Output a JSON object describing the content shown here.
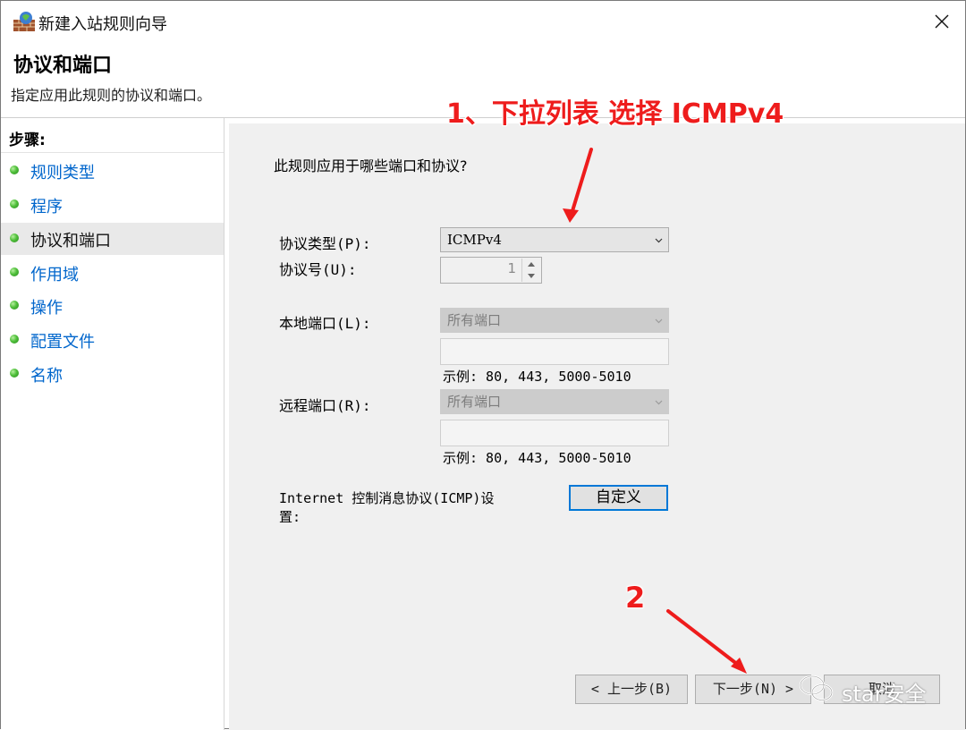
{
  "window": {
    "title": "新建入站规则向导"
  },
  "header": {
    "title": "协议和端口",
    "description": "指定应用此规则的协议和端口。"
  },
  "sidebar": {
    "steps_label": "步骤:",
    "items": [
      {
        "label": "规则类型",
        "active": false
      },
      {
        "label": "程序",
        "active": false
      },
      {
        "label": "协议和端口",
        "active": true
      },
      {
        "label": "作用域",
        "active": false
      },
      {
        "label": "操作",
        "active": false
      },
      {
        "label": "配置文件",
        "active": false
      },
      {
        "label": "名称",
        "active": false
      }
    ]
  },
  "content": {
    "question": "此规则应用于哪些端口和协议?",
    "protocol_type_label": "协议类型(P):",
    "protocol_type_value": "ICMPv4",
    "protocol_number_label": "协议号(U):",
    "protocol_number_value": "1",
    "local_port_label": "本地端口(L):",
    "local_port_value": "所有端口",
    "local_port_hint": "示例: 80, 443, 5000-5010",
    "remote_port_label": "远程端口(R):",
    "remote_port_value": "所有端口",
    "remote_port_hint": "示例: 80, 443, 5000-5010",
    "icmp_label_line1": "Internet 控制消息协议(ICMP)设",
    "icmp_label_line2": "置:",
    "custom_button": "自定义"
  },
  "footer": {
    "back_button": "< 上一步(B)",
    "next_button": "下一步(N) >",
    "cancel_button": "取消"
  },
  "annotations": {
    "step1": "1、下拉列表 选择 ICMPv4",
    "step2": "2"
  },
  "watermark": {
    "text": "star安全"
  },
  "colors": {
    "annotation": "#ee1c1c",
    "link": "#0066cc",
    "focus_border": "#0078d7"
  }
}
